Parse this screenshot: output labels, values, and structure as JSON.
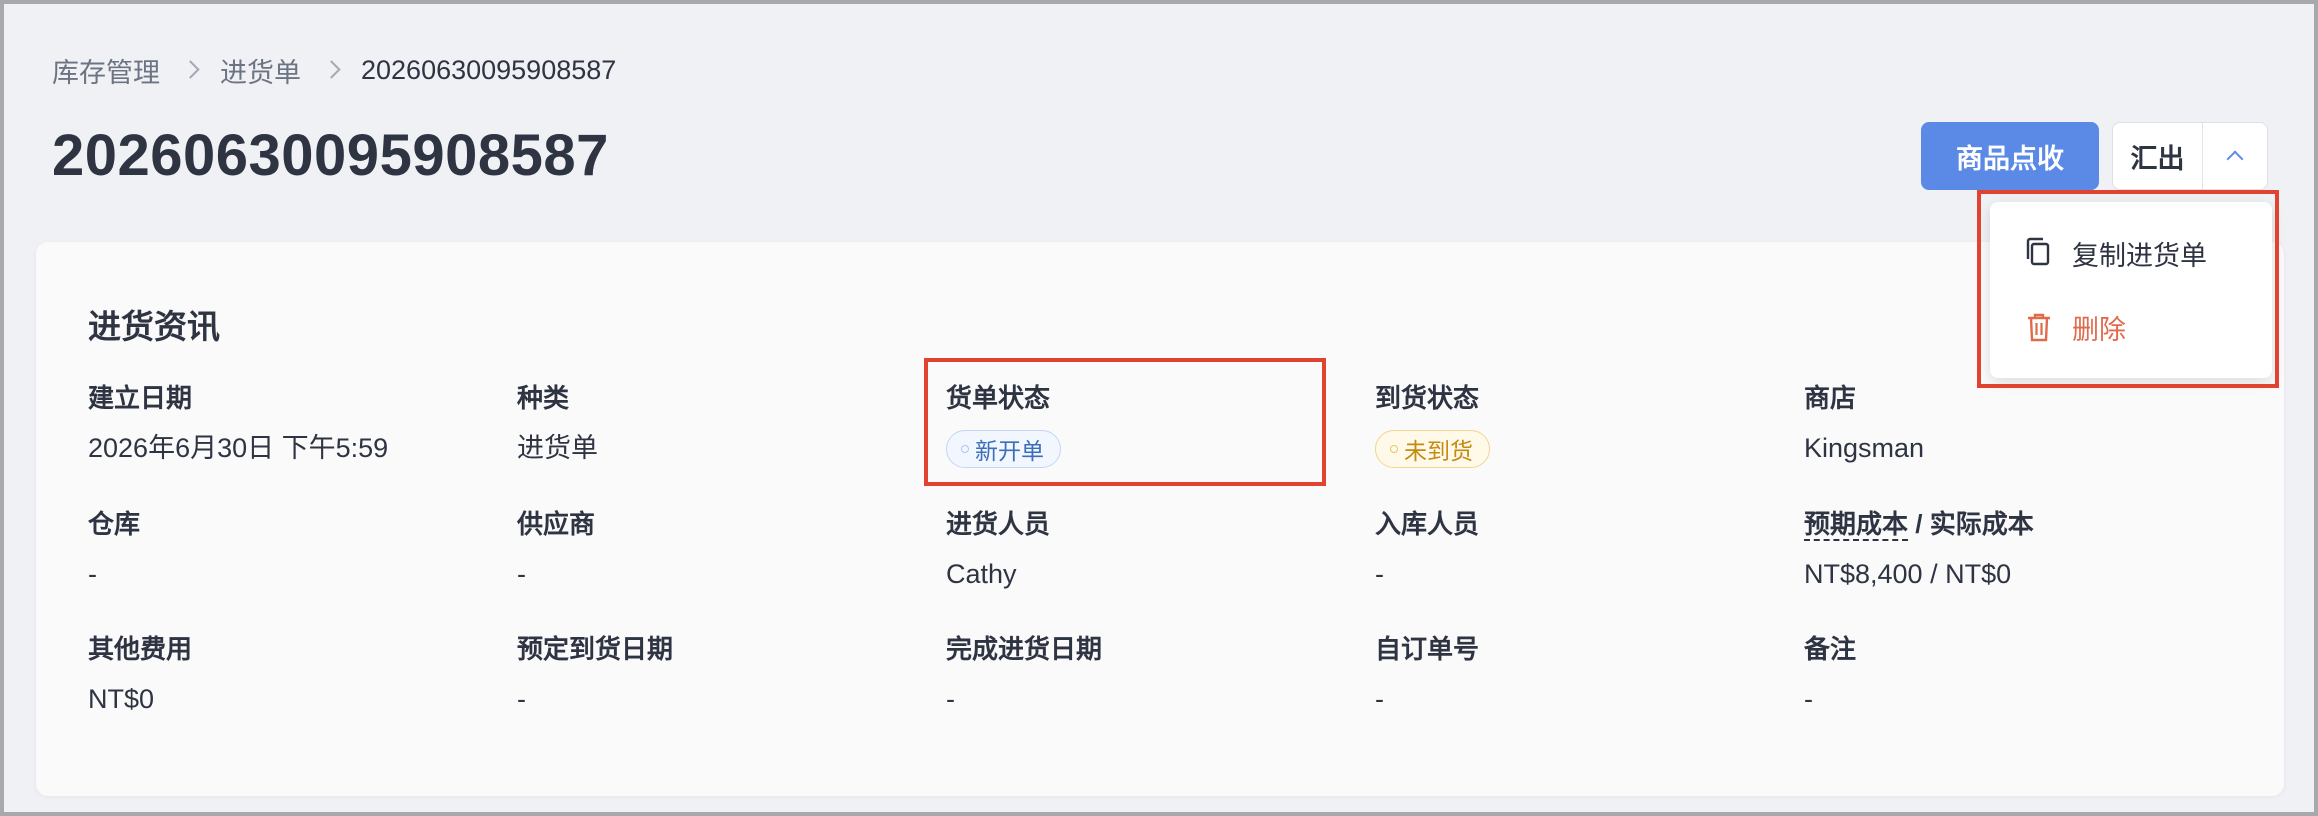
{
  "breadcrumb": {
    "items": [
      "库存管理",
      "进货单"
    ],
    "current": "20260630095908587"
  },
  "page": {
    "title": "20260630095908587"
  },
  "actions": {
    "primary_label": "商品点收",
    "export_label": "汇出"
  },
  "dropdown": {
    "items": [
      {
        "label": "复制进货单",
        "icon": "copy-icon"
      },
      {
        "label": "删除",
        "icon": "trash-icon",
        "color": "#e06b4c"
      }
    ]
  },
  "info": {
    "section_title": "进货资讯",
    "created_date": {
      "label": "建立日期",
      "value": "2026年6月30日 下午5:59"
    },
    "type": {
      "label": "种类",
      "value": "进货单"
    },
    "order_status": {
      "label": "货单状态",
      "value": "新开单",
      "color": "#3d6fb8"
    },
    "arrival_status": {
      "label": "到货状态",
      "value": "未到货",
      "color": "#c58a10"
    },
    "store": {
      "label": "商店",
      "value": "Kingsman"
    },
    "warehouse": {
      "label": "仓库",
      "value": "-"
    },
    "supplier": {
      "label": "供应商",
      "value": "-"
    },
    "purchaser": {
      "label": "进货人员",
      "value": "Cathy"
    },
    "receiver": {
      "label": "入库人员",
      "value": "-"
    },
    "cost": {
      "label_expected": "预期成本",
      "label_sep": " / ",
      "label_actual": "实际成本",
      "value": "NT$8,400 / NT$0"
    },
    "other_fees": {
      "label": "其他费用",
      "value": "NT$0"
    },
    "expected_arrival": {
      "label": "预定到货日期",
      "value": "-"
    },
    "completed_date": {
      "label": "完成进货日期",
      "value": "-"
    },
    "custom_no": {
      "label": "自订单号",
      "value": "-"
    },
    "notes": {
      "label": "备注",
      "value": "-"
    }
  },
  "colors": {
    "primary": "#5b8ae6",
    "highlight": "#e0432f",
    "danger": "#e06b4c"
  }
}
